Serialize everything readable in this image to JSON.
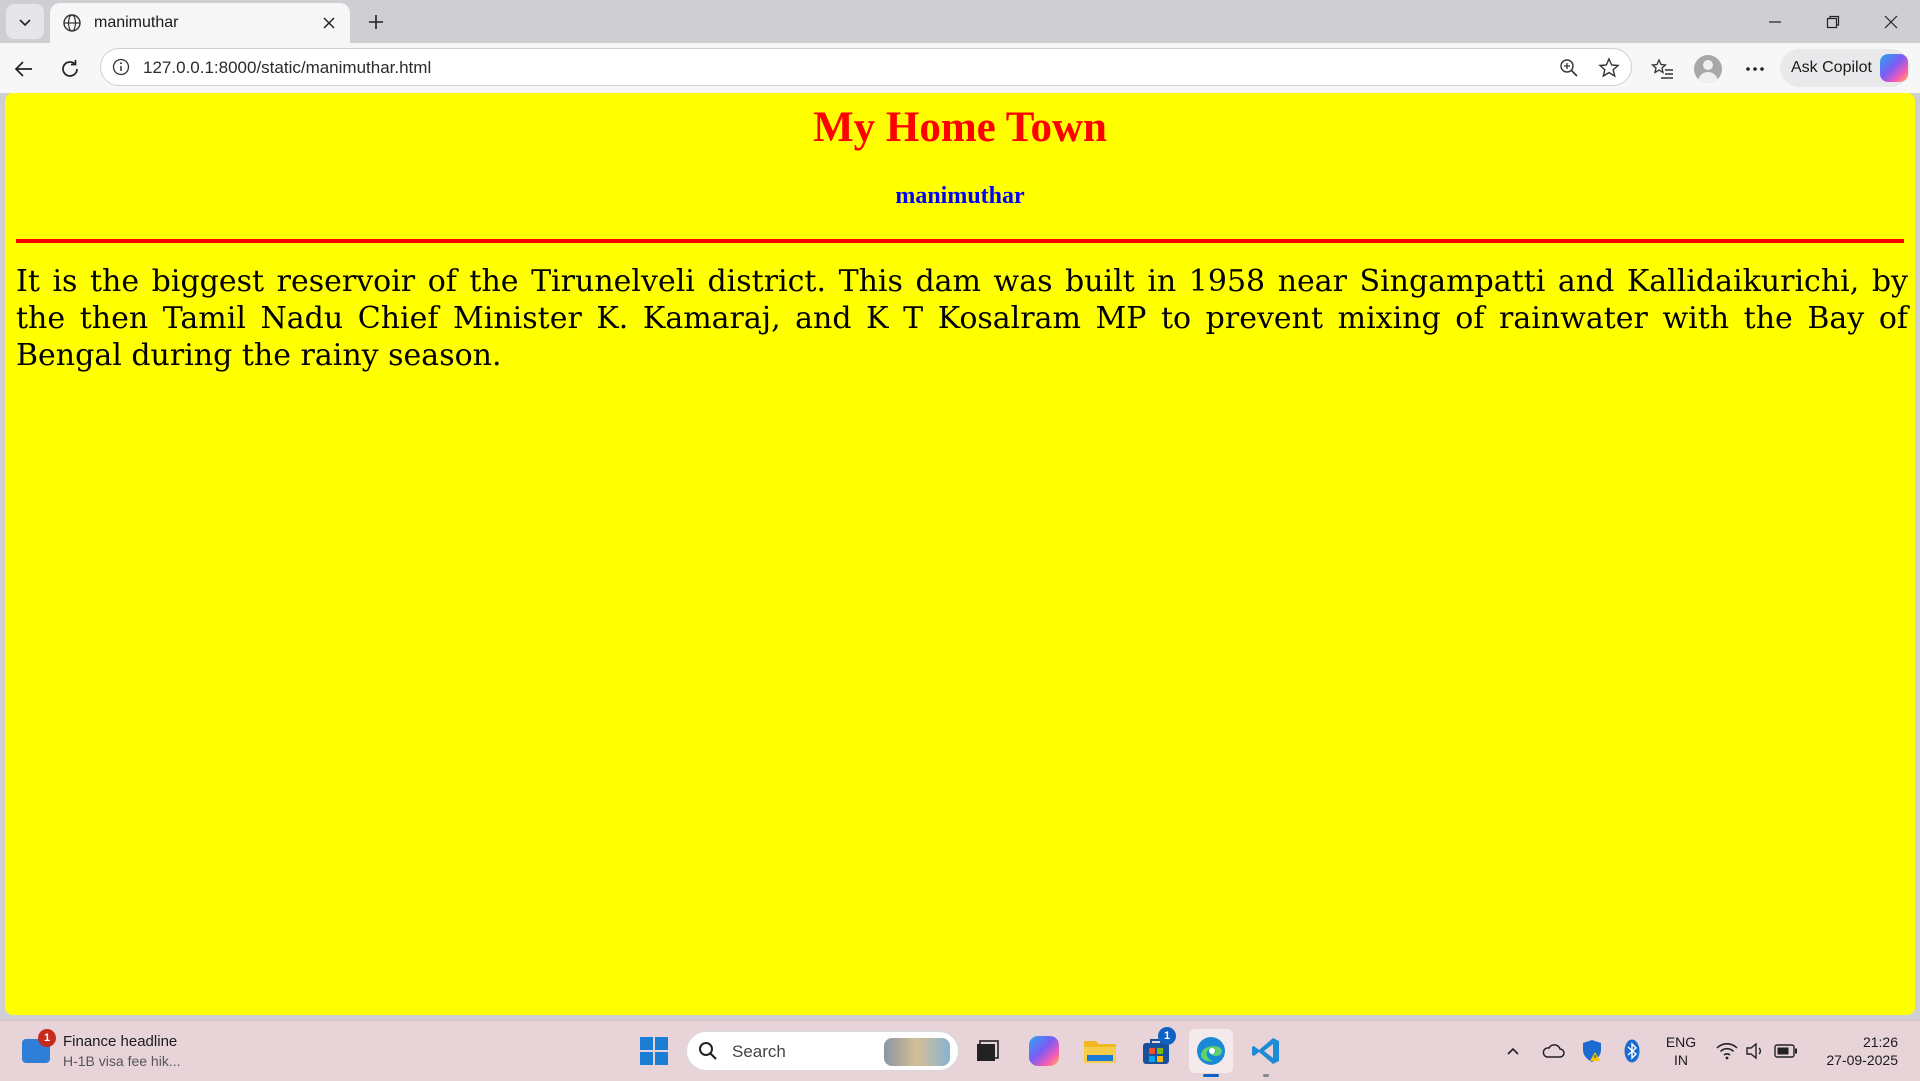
{
  "browser": {
    "tab_title": "manimuthar",
    "url": "127.0.0.1:8000/static/manimuthar.html",
    "copilot_label": "Ask Copilot"
  },
  "page": {
    "heading": "My Home Town",
    "subheading": "manimuthar",
    "paragraph": "It is the biggest reservoir of the Tirunelveli district. This dam was built in 1958 near Singampatti and Kallidaikurichi, by the then Tamil Nadu Chief Minister K. Kamaraj, and K T Kosalram MP to prevent mixing of rainwater with the Bay of Bengal during the rainy season.",
    "background_color": "#ffff00",
    "heading_color": "#ff0000",
    "subheading_color": "#0000ff",
    "rule_color": "#ff0000"
  },
  "taskbar": {
    "widget_title": "Finance headline",
    "widget_subtitle": "H-1B visa fee hik...",
    "widget_badge": "1",
    "search_placeholder": "Search",
    "store_badge": "1",
    "lang_line1": "ENG",
    "lang_line2": "IN",
    "time": "21:26",
    "date": "27-09-2025"
  },
  "icons": {
    "tab_list": "chevron-down-icon",
    "favicon": "globe-icon",
    "tab_close": "close-icon",
    "new_tab": "plus-icon",
    "back": "arrow-left-icon",
    "refresh": "refresh-icon",
    "site_info": "info-icon",
    "zoom": "zoom-icon",
    "favorite": "star-icon",
    "favorites": "favorites-list-icon",
    "profile": "avatar",
    "more": "more-icon"
  }
}
